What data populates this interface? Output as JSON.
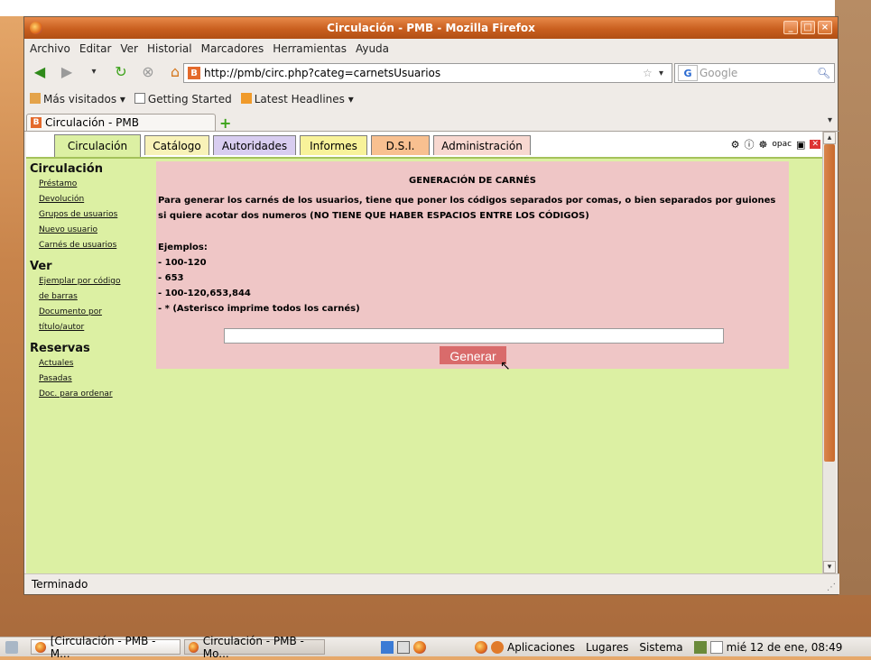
{
  "window": {
    "title": "Circulación - PMB - Mozilla Firefox",
    "controls": [
      "_",
      "□",
      "×"
    ]
  },
  "menubar": {
    "items": [
      "Archivo",
      "Editar",
      "Ver",
      "Historial",
      "Marcadores",
      "Herramientas",
      "Ayuda"
    ]
  },
  "navbar": {
    "url": "http://pmb/circ.php?categ=carnetsUsuarios",
    "search_placeholder": "Google"
  },
  "bookmarks": {
    "items": [
      "Más visitados",
      "Getting Started",
      "Latest Headlines"
    ]
  },
  "tabs": {
    "active_label": "Circulación - PMB"
  },
  "pmb": {
    "tabs": [
      "Circulación",
      "Catálogo",
      "Autoridades",
      "Informes",
      "D.S.I.",
      "Administración"
    ],
    "tab_colors": [
      "#dcf0a3",
      "#f8f2b8",
      "#d8cdf0",
      "#f8f29a",
      "#f8c090",
      "#f8d8d0"
    ],
    "sidebar": {
      "circulacion": {
        "heading": "Circulación",
        "links": [
          "Préstamo",
          "Devolución",
          "Grupos de usuarios",
          "Nuevo usuario",
          "Carnés de usuarios"
        ]
      },
      "ver": {
        "heading": "Ver",
        "links": [
          "Ejemplar por código",
          "de barras",
          "Documento por",
          "título/autor"
        ]
      },
      "reservas": {
        "heading": "Reservas",
        "links": [
          "Actuales",
          "Pasadas",
          "Doc. para ordenar"
        ]
      }
    },
    "main": {
      "title": "GENERACIÓN DE CARNÉS",
      "description": "Para generar los carnés de los usuarios, tiene que poner los códigos separados por comas, o bien separados por guiones si quiere acotar dos numeros (NO TIENE QUE HABER ESPACIOS ENTRE LOS CÓDIGOS)",
      "examples_heading": "Ejemplos:",
      "examples": [
        "- 100-120",
        "- 653",
        "- 100-120,653,844",
        "- * (Asterisco imprime todos los carnés)"
      ],
      "input_value": "",
      "button_label": "Generar"
    }
  },
  "statusbar": {
    "text": "Terminado"
  },
  "panel": {
    "tasks": [
      "[Circulación - PMB - M...",
      "Circulación - PMB - Mo..."
    ],
    "menus": [
      "Aplicaciones",
      "Lugares",
      "Sistema"
    ],
    "clock": "mié 12 de ene, 08:49"
  }
}
